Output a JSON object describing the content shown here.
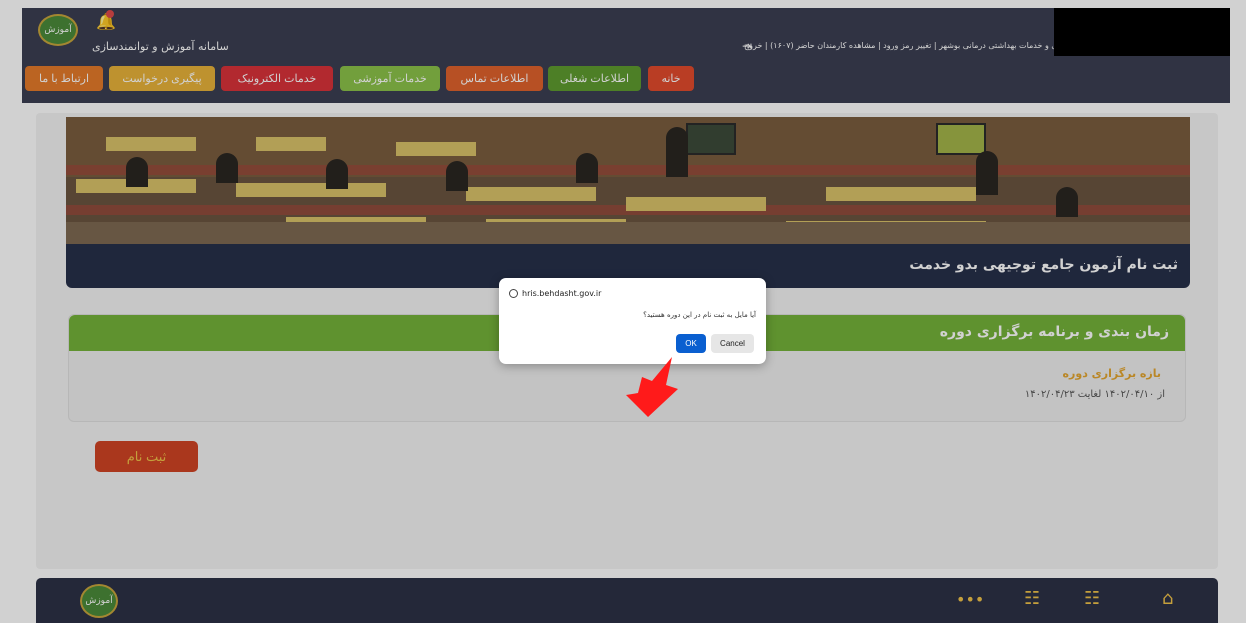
{
  "header": {
    "app_title": "سامانه آموزش و توانمندسازی",
    "logo_text": "آموزش",
    "user_links": "دانشگاه علوم پزشکی و خدمات بهداشتی درمانی بوشهر | تغییر رمز ورود | مشاهده کارمندان حاضر (۱۶۰۷) | خروج",
    "logout_icon": "logout-icon"
  },
  "menu": {
    "items": [
      {
        "label": "خانه",
        "color": "#e24b2d"
      },
      {
        "label": "اطلاعات شغلی",
        "color": "#5e9c2f"
      },
      {
        "label": "اطلاعات تماس",
        "color": "#e0622d"
      },
      {
        "label": "خدمات آموزشی",
        "color": "#8bc34a"
      },
      {
        "label": "خدمات الکترونیک",
        "color": "#d9323a"
      },
      {
        "label": "پیگیری درخواست",
        "color": "#e8b23a"
      },
      {
        "label": "ارتباط با ما",
        "color": "#e47a2a"
      }
    ]
  },
  "course": {
    "title": "ثبت نام آزمون جامع توجیهی بدو خدمت",
    "schedule_heading": "زمان بندی و برنامه برگزاری دوره",
    "period_label": "بازه برگزاری دوره",
    "period_range": "از ۱۴۰۲/۰۴/۱۰ لغایت ۱۴۰۲/۰۴/۲۳",
    "register_label": "ثبت نام"
  },
  "dialog": {
    "origin": "hris.behdasht.gov.ir",
    "message": "آیا مایل به ثبت نام در این دوره هستید؟",
    "ok_label": "OK",
    "cancel_label": "Cancel"
  },
  "footer": {
    "logo_text": "آموزش",
    "icons": [
      "more-icon",
      "teacher-icon",
      "grid-icon",
      "home-icon"
    ]
  }
}
